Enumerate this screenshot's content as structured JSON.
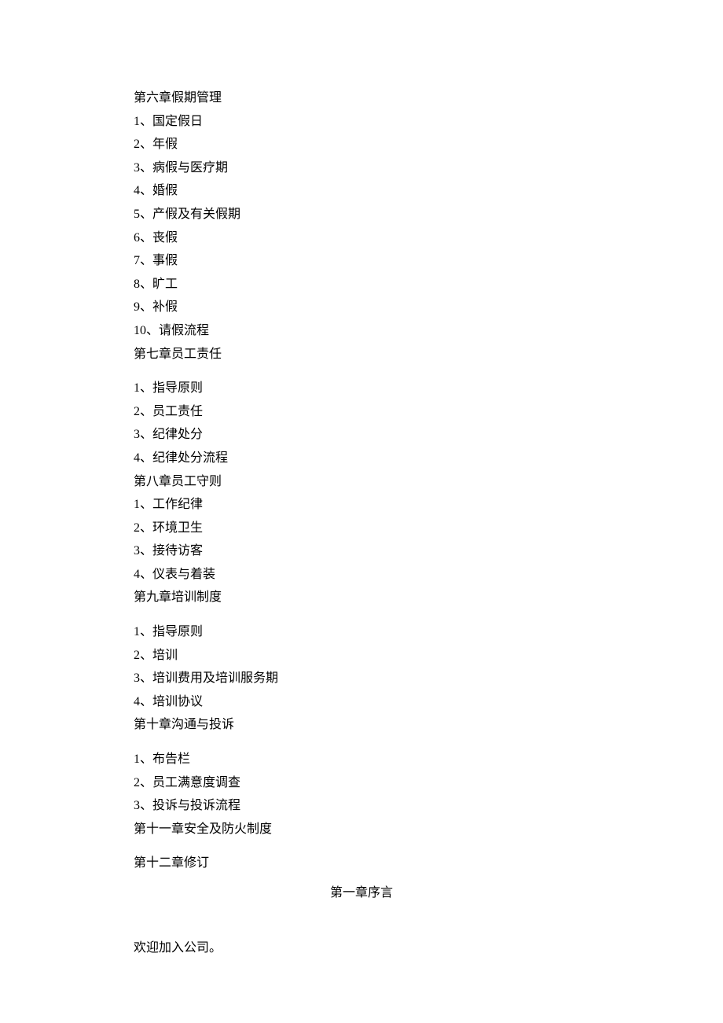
{
  "lines": [
    "第六章假期管理",
    "1、国定假日",
    "2、年假",
    "3、病假与医疗期",
    "4、婚假",
    "5、产假及有关假期",
    "6、丧假",
    "7、事假",
    "8、旷工",
    "9、补假",
    "10、请假流程",
    "第七章员工责任"
  ],
  "group2": [
    "1、指导原则",
    "2、员工责任",
    "3、纪律处分",
    "4、纪律处分流程",
    "第八章员工守则",
    "1、工作纪律",
    "2、环境卫生",
    "3、接待访客",
    "4、仪表与着装",
    "第九章培训制度"
  ],
  "group3": [
    "1、指导原则",
    "2、培训",
    "3、培训费用及培训服务期",
    "4、培训协议",
    "第十章沟通与投诉"
  ],
  "group4": [
    "1、布告栏",
    "2、员工满意度调查",
    "3、投诉与投诉流程",
    "第十一章安全及防火制度"
  ],
  "group5": [
    "第十二章修订"
  ],
  "centered_heading": "第一章序言",
  "footer": "欢迎加入公司。"
}
